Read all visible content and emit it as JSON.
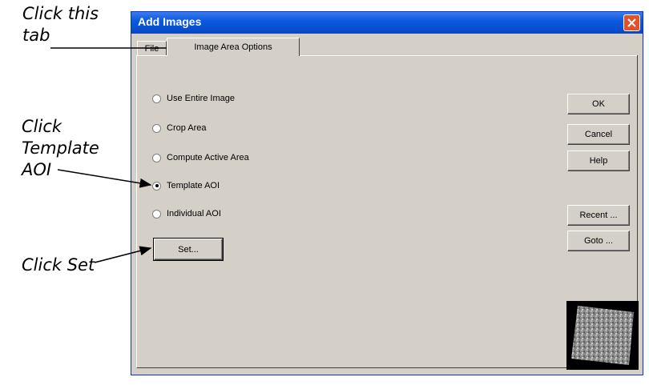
{
  "annotations": {
    "click_tab": "Click this\ntab",
    "click_template": "Click\nTemplate\nAOI",
    "click_set": "Click Set"
  },
  "window": {
    "title": "Add Images",
    "close_icon": "close-icon"
  },
  "tabs": [
    {
      "label": "File",
      "active": false
    },
    {
      "label": "Image Area Options",
      "active": true
    }
  ],
  "options": [
    {
      "label": "Use Entire Image",
      "checked": false
    },
    {
      "label": "Crop Area",
      "checked": false
    },
    {
      "label": "Compute Active Area",
      "checked": false
    },
    {
      "label": "Template AOI",
      "checked": true
    },
    {
      "label": "Individual AOI",
      "checked": false
    }
  ],
  "buttons": {
    "set": "Set...",
    "ok": "OK",
    "cancel": "Cancel",
    "help": "Help",
    "recent": "Recent ...",
    "goto": "Goto ..."
  },
  "colors": {
    "titlebar": "#0a5ae0",
    "dialog_bg": "#d4d0c8",
    "close_button": "#e0512c"
  }
}
